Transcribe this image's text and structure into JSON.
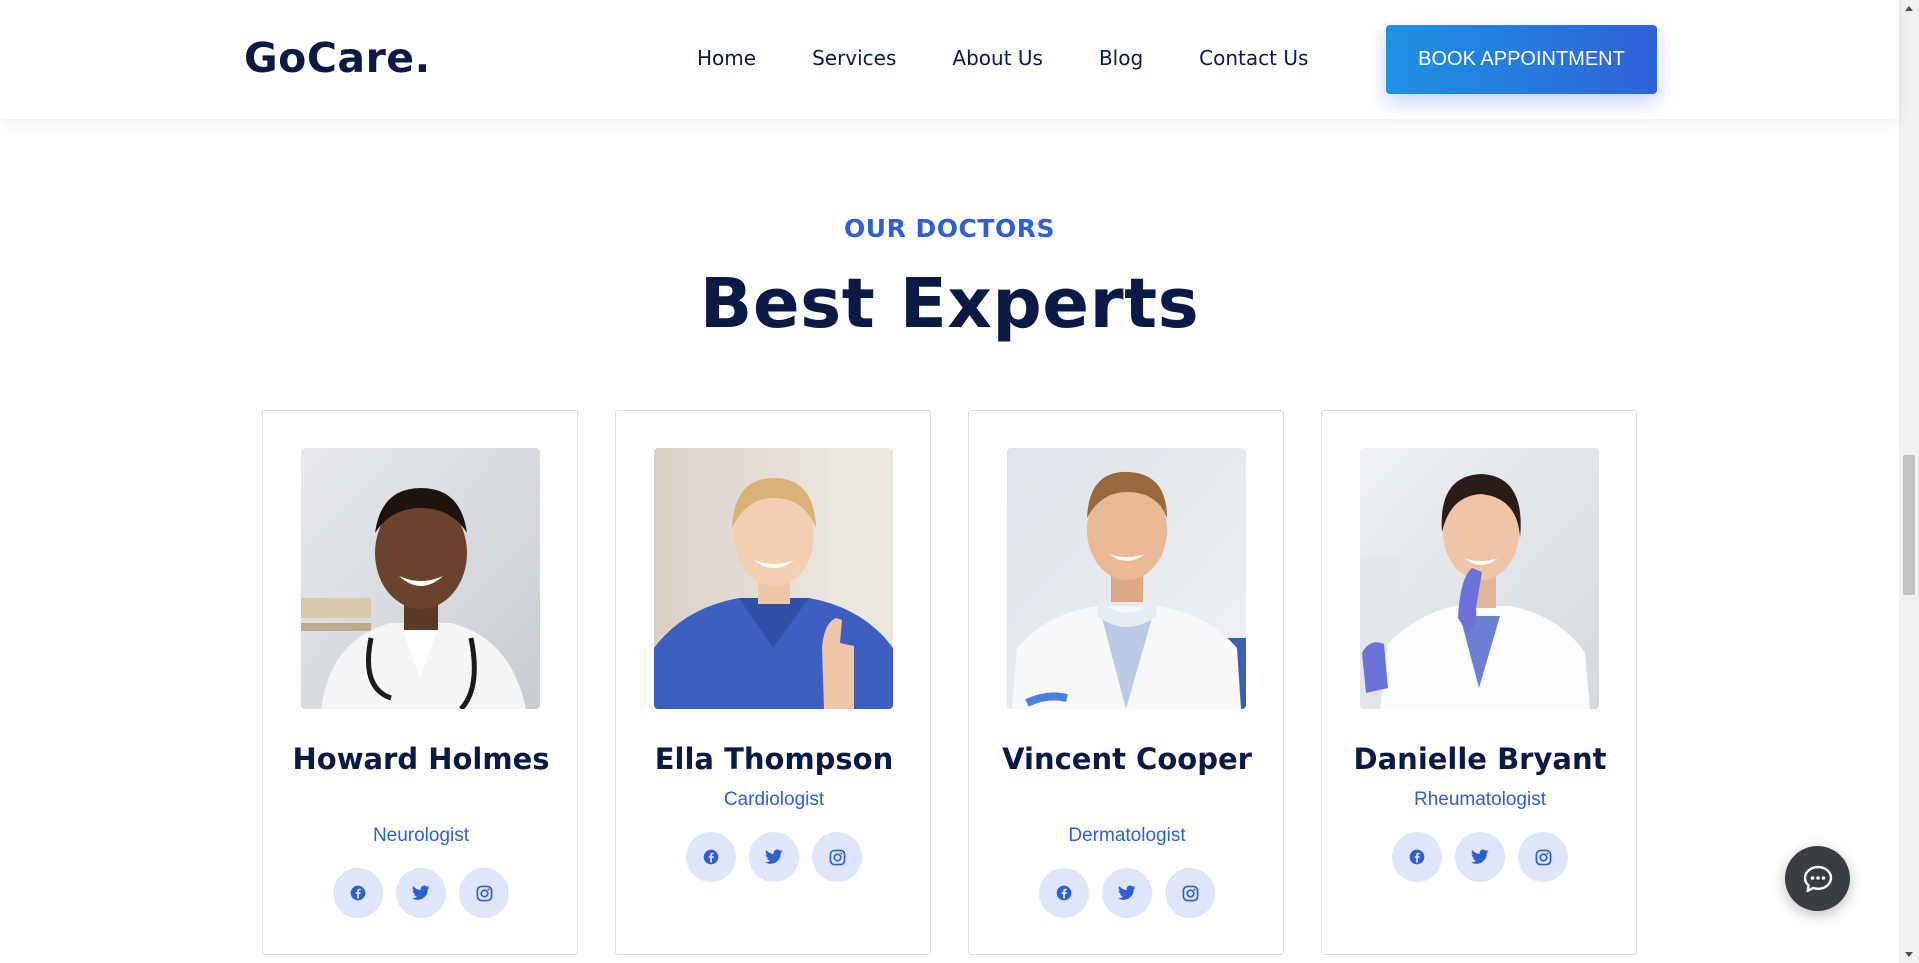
{
  "brand": {
    "logo_text": "GoCare."
  },
  "nav": {
    "items": [
      {
        "label": "Home"
      },
      {
        "label": "Services"
      },
      {
        "label": "About Us"
      },
      {
        "label": "Blog"
      },
      {
        "label": "Contact Us"
      }
    ],
    "cta_label": "BOOK APPOINTMENT"
  },
  "section": {
    "eyebrow": "OUR DOCTORS",
    "title": "Best Experts"
  },
  "doctors": [
    {
      "name": "Howard Holmes",
      "role": "Neurologist"
    },
    {
      "name": "Ella Thompson",
      "role": "Cardiologist"
    },
    {
      "name": "Vincent Cooper",
      "role": "Dermatologist"
    },
    {
      "name": "Danielle Bryant",
      "role": "Rheumatologist"
    }
  ],
  "social_icons": [
    "facebook-icon",
    "twitter-icon",
    "instagram-icon"
  ],
  "colors": {
    "brand_dark": "#0b1a45",
    "accent_blue": "#2f5fd0",
    "cta_gradient_start": "#1d92e3",
    "cta_gradient_end": "#2f62d8",
    "social_bg": "#dfe6fb",
    "chat_bg": "#3a3d42"
  }
}
